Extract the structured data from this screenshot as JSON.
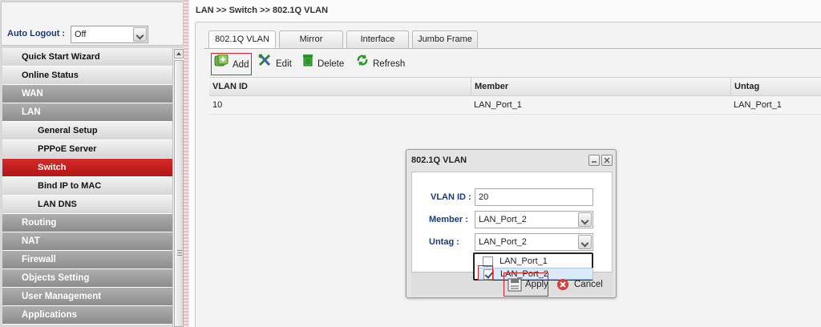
{
  "sidebar": {
    "auto_logout_label": "Auto Logout :",
    "auto_logout_value": "Off",
    "menu": [
      {
        "label": "Quick Start Wizard",
        "kind": "main"
      },
      {
        "label": "Online Status",
        "kind": "main"
      },
      {
        "label": "WAN",
        "kind": "category"
      },
      {
        "label": "LAN",
        "kind": "category"
      },
      {
        "label": "General Setup",
        "kind": "sub"
      },
      {
        "label": "PPPoE Server",
        "kind": "sub"
      },
      {
        "label": "Switch",
        "kind": "sub",
        "active": true
      },
      {
        "label": "Bind IP to MAC",
        "kind": "sub"
      },
      {
        "label": "LAN DNS",
        "kind": "sub"
      },
      {
        "label": "Routing",
        "kind": "category"
      },
      {
        "label": "NAT",
        "kind": "category"
      },
      {
        "label": "Firewall",
        "kind": "category"
      },
      {
        "label": "Objects Setting",
        "kind": "category"
      },
      {
        "label": "User Management",
        "kind": "category"
      },
      {
        "label": "Applications",
        "kind": "category"
      }
    ]
  },
  "breadcrumb": "LAN >> Switch >> 802.1Q VLAN",
  "tabs": [
    "802.1Q VLAN",
    "Mirror",
    "Interface",
    "Jumbo Frame"
  ],
  "toolbar": {
    "add": "Add",
    "edit": "Edit",
    "delete": "Delete",
    "refresh": "Refresh"
  },
  "table": {
    "headers": [
      "VLAN ID",
      "Member",
      "Untag"
    ],
    "rows": [
      [
        "10",
        "LAN_Port_1",
        "LAN_Port_1"
      ]
    ]
  },
  "dialog": {
    "title": "802.1Q VLAN",
    "vlan_id_label": "VLAN ID :",
    "vlan_id_value": "20",
    "member_label": "Member :",
    "member_value": "LAN_Port_2",
    "untag_label": "Untag :",
    "untag_value": "LAN_Port_2",
    "untag_options": [
      {
        "label": "LAN_Port_1",
        "checked": false
      },
      {
        "label": "LAN_Port_2",
        "checked": true
      }
    ],
    "apply": "Apply",
    "cancel": "Cancel"
  },
  "colors": {
    "accent_red": "#e02020",
    "active_menu": "#c41f1f",
    "label_blue": "#1a3b78"
  }
}
